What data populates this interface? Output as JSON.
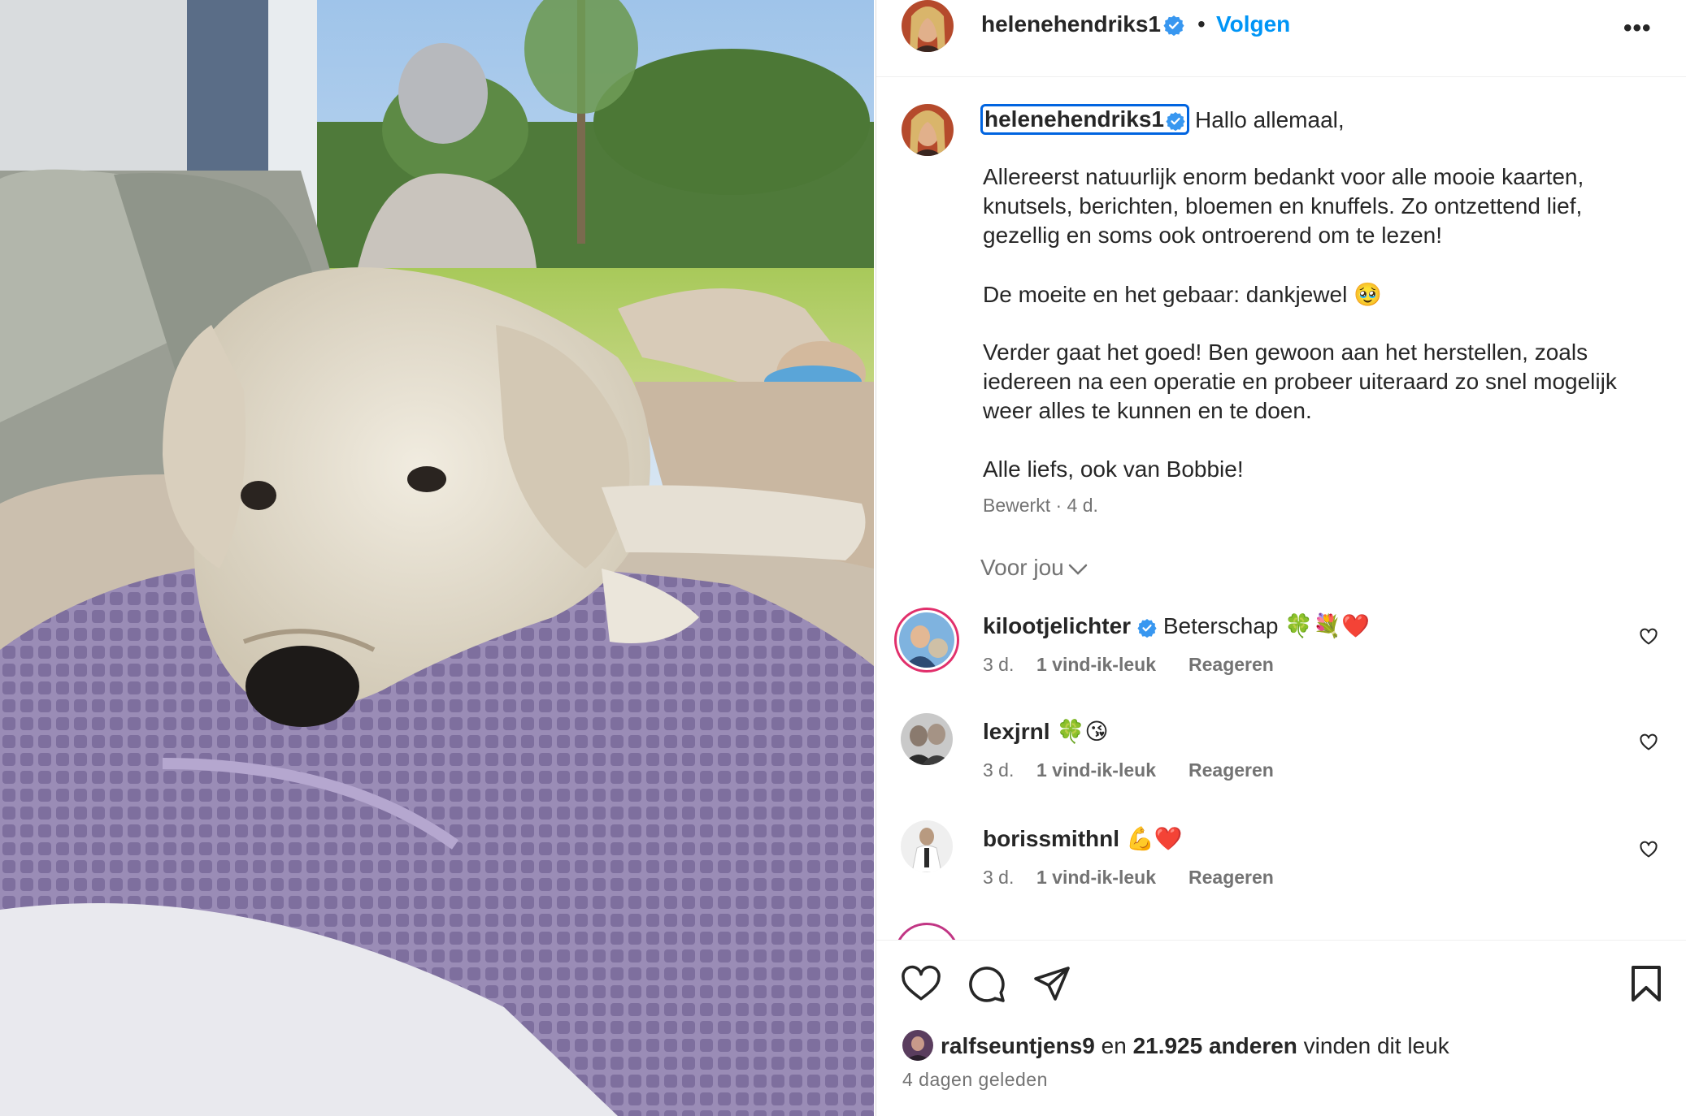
{
  "post": {
    "author": "helenehendriks1",
    "separator": "•",
    "follow_label": "Volgen",
    "more_label": "•••"
  },
  "caption": {
    "author": "helenehendriks1",
    "lines": [
      "Hallo allemaal,",
      "Allereerst natuurlijk enorm bedankt voor alle mooie kaarten,",
      "knutsels, berichten, bloemen en knuffels. Zo ontzettend lief,",
      "gezellig en soms ook ontroerend om te lezen!",
      "De moeite en het gebaar: dankjewel 🥹",
      "Verder gaat het goed! Ben gewoon aan het herstellen, zoals",
      "iedereen na een operatie en probeer uiteraard zo snel mogelijk",
      "weer alles te kunnen en te doen.",
      "Alle liefs, ook van Bobbie!"
    ],
    "meta": "Bewerkt · 4 d."
  },
  "comments_sort": {
    "label": "Voor jou"
  },
  "comments": [
    {
      "user": "kilootjelichter",
      "verified": true,
      "text": "Beterschap 🍀💐❤️",
      "time": "3 d.",
      "likes": "1 vind-ik-leuk",
      "reply": "Reageren"
    },
    {
      "user": "lexjrnl",
      "verified": false,
      "text": "🍀😘",
      "time": "3 d.",
      "likes": "1 vind-ik-leuk",
      "reply": "Reageren"
    },
    {
      "user": "borissmithnl",
      "verified": false,
      "text": "💪❤️",
      "time": "3 d.",
      "likes": "1 vind-ik-leuk",
      "reply": "Reageren"
    }
  ],
  "likes": {
    "first_user": "ralfseuntjens9",
    "middle": " en ",
    "count_text": "21.925 anderen",
    "suffix": " vinden dit leuk"
  },
  "post_date": "4 dagen geleden",
  "colors": {
    "accent_blue": "#0095f6",
    "verified_blue": "#3897f0",
    "text_primary": "#262626",
    "text_secondary": "#737373",
    "focus_outline": "#0064e0"
  },
  "icons": [
    "verified-icon",
    "more-icon",
    "chevron-down-icon",
    "heart-icon",
    "comment-icon",
    "share-icon",
    "bookmark-icon"
  ]
}
